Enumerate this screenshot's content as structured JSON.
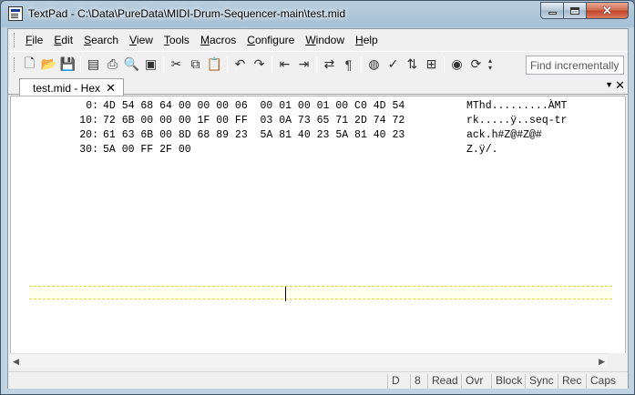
{
  "window": {
    "title": "TextPad - C:\\Data\\PureData\\MIDI-Drum-Sequencer-main\\test.mid",
    "close_glyph": "✕"
  },
  "menu": [
    {
      "label": "File",
      "u": "F",
      "rest": "ile"
    },
    {
      "label": "Edit",
      "u": "E",
      "rest": "dit"
    },
    {
      "label": "Search",
      "u": "S",
      "rest": "earch"
    },
    {
      "label": "View",
      "u": "V",
      "rest": "iew"
    },
    {
      "label": "Tools",
      "u": "T",
      "rest": "ools"
    },
    {
      "label": "Macros",
      "u": "M",
      "rest": "acros"
    },
    {
      "label": "Configure",
      "u": "C",
      "rest": "onfigure"
    },
    {
      "label": "Window",
      "u": "W",
      "rest": "indow"
    },
    {
      "label": "Help",
      "u": "H",
      "rest": "elp"
    }
  ],
  "toolbar": {
    "find_placeholder": "Find incrementally",
    "icons": [
      "new-file-icon",
      "open-folder-icon",
      "save-icon",
      "save-all-icon",
      "print-icon",
      "print-preview-icon",
      "word-wrap-icon",
      "cut-icon",
      "copy-icon",
      "paste-icon",
      "undo-icon",
      "redo-icon",
      "unindent-icon",
      "indent-icon",
      "replace-icon",
      "pilcrow-icon",
      "globe-icon",
      "spell-check-icon",
      "sort-icon",
      "manage-files-icon",
      "view-icon",
      "compare-icon"
    ]
  },
  "tabs": {
    "active_label": "test.mid - Hex",
    "close": "✕",
    "list_arrow": "▼",
    "doc_close": "✕"
  },
  "hex": {
    "rows": [
      {
        "offset": "0:",
        "bytes": "4D 54 68 64 00 00 00 06  00 01 00 01 00 C0 4D 54",
        "ascii": "MThd.........ÀMT"
      },
      {
        "offset": "10:",
        "bytes": "72 6B 00 00 00 1F 00 FF  03 0A 73 65 71 2D 74 72",
        "ascii": "rk.....ÿ..seq-tr"
      },
      {
        "offset": "20:",
        "bytes": "61 63 6B 00 8D 68 89 23  5A 81 40 23 5A 81 40 23",
        "ascii": "ack.h#Z@#Z@#"
      },
      {
        "offset": "30:",
        "bytes": "5A 00 FF 2F 00",
        "ascii": "Z.ÿ/."
      }
    ]
  },
  "scroll": {
    "left": "◀",
    "right": "▶"
  },
  "status": {
    "cells": [
      {
        "label": "D"
      },
      {
        "label": "8"
      },
      {
        "label": "Read"
      },
      {
        "label": "Ovr"
      },
      {
        "label": "Block"
      },
      {
        "label": "Sync"
      },
      {
        "label": "Rec"
      },
      {
        "label": "Caps"
      }
    ]
  }
}
